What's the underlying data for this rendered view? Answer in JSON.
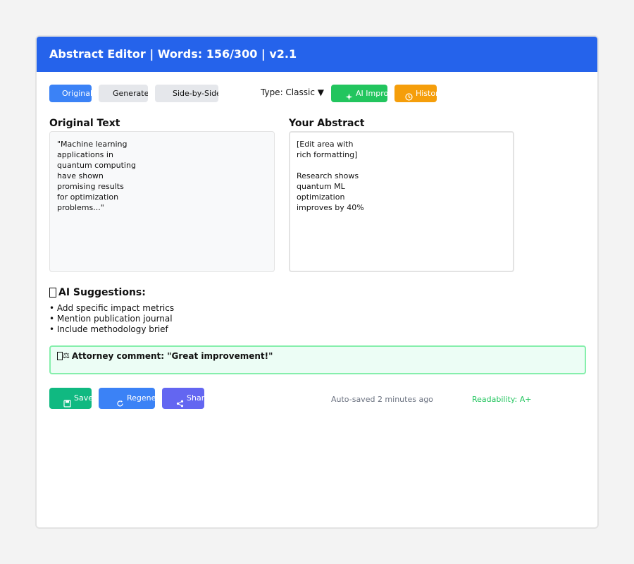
{
  "header": {
    "title": "Abstract Editor | Words: 156/300 | v2.1"
  },
  "toolbar": {
    "tabs": [
      {
        "label": "Original",
        "active": true
      },
      {
        "label": "Generated",
        "active": false
      },
      {
        "label": "Side-by-Side",
        "active": false
      }
    ],
    "type_select": "Type: Classic ▼",
    "ai_improve_label": "AI Improve",
    "history_label": "History"
  },
  "original": {
    "title": "Original Text",
    "text": "\"Machine learning\napplications in\nquantum computing\nhave shown\npromising results\nfor optimization\nproblems...\""
  },
  "abstract": {
    "title": "Your Abstract",
    "text": "[Edit area with\nrich formatting]\n\nResearch shows\nquantum ML\noptimization\nimproves by 40%"
  },
  "suggestions": {
    "title": "AI Suggestions:",
    "items": [
      "• Add specific impact metrics",
      "• Mention publication journal",
      "• Include methodology brief"
    ]
  },
  "comment": {
    "text": "Attorney comment: \"Great improvement!\""
  },
  "actions": {
    "save_label": "Save",
    "regenerate_label": "Regenerate",
    "share_label": "Share"
  },
  "status": {
    "autosave": "Auto-saved 2 minutes ago",
    "readability": "Readability: A+"
  },
  "colors": {
    "header": "#2563eb",
    "tab_active": "#3b82f6",
    "ai_improve": "#22c55e",
    "history": "#f59e0b",
    "save": "#10b981",
    "regenerate": "#3b82f6",
    "share": "#6366f1",
    "comment_bg": "#ecfdf5",
    "comment_border": "#86efac",
    "readability": "#22c55e"
  },
  "icons": {
    "ai_improve": "sparkle-icon",
    "history": "history-icon",
    "suggestions": "lightbulb-icon",
    "comment": "scale-icon",
    "save": "save-icon",
    "regenerate": "refresh-icon",
    "share": "share-icon"
  }
}
